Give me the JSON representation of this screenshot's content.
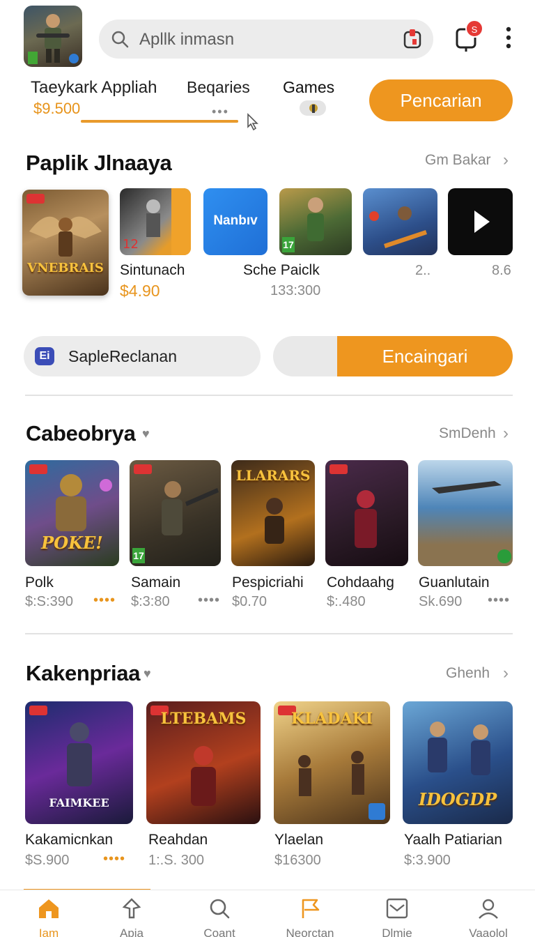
{
  "header": {
    "search_placeholder": "Apllk inmasn",
    "notification_count": "S",
    "app_title": "Taeykark Appliah",
    "app_price": "$9.500",
    "categories_label": "Beqaries",
    "games_label": "Games",
    "primary_button": "Pencarian",
    "progress": 1.0
  },
  "section1": {
    "title": "Paplik Jlnaaya",
    "link": "Gm Bakar",
    "featured_tile_text": "VNEBRAIS",
    "items": [
      {
        "name": "Sintunach",
        "price": "$4.90",
        "tile_text": ""
      },
      {
        "name": "Sche Paiclk",
        "price": "133:300",
        "tile_text": "Nanbıv"
      },
      {
        "name": "",
        "price": "2..",
        "tile_text": ""
      },
      {
        "name": "",
        "price": "8.6",
        "tile_text": ""
      }
    ]
  },
  "action_row": {
    "left_label": "SapleReclanan",
    "left_icon_text": "Ei",
    "right_label": "Encaingari"
  },
  "section2": {
    "title": "Cabeobrya",
    "link": "SmDenh",
    "items": [
      {
        "name": "Polk",
        "price": "$:S:390",
        "tile_text": "POKE!"
      },
      {
        "name": "Samain",
        "price": "$:3:80",
        "tile_text": ""
      },
      {
        "name": "Pespicriahi",
        "price": "$0.70",
        "tile_text": "LLARARS"
      },
      {
        "name": "Cohdaahg",
        "price": "$:.480",
        "tile_text": ""
      },
      {
        "name": "Guanlutain",
        "price": "Sk.690",
        "tile_text": ""
      }
    ],
    "rating_badge": "17"
  },
  "section3": {
    "title": "Kakenpriaa",
    "link": "Ghenh",
    "items": [
      {
        "name": "Kakamicnkan",
        "price": "$S.900",
        "tile_text": "FAIMKEE"
      },
      {
        "name": "Reahdan",
        "price": "1:.S. 300",
        "tile_text": "LTEBAMS"
      },
      {
        "name": "Ylaelan",
        "price": "$16300",
        "tile_text": "KLADAKI"
      },
      {
        "name": "Yaalh Patiarian",
        "price": "$:3.900",
        "tile_text": "IDOGDP"
      }
    ]
  },
  "bottom_nav": [
    {
      "label": "Iam",
      "icon": "home-icon"
    },
    {
      "label": "Apia",
      "icon": "pin-icon"
    },
    {
      "label": "Coant",
      "icon": "search-icon"
    },
    {
      "label": "Neorctan",
      "icon": "flag-icon"
    },
    {
      "label": "Dlmie",
      "icon": "mail-icon"
    },
    {
      "label": "Vaaolol",
      "icon": "profile-icon"
    }
  ],
  "colors": {
    "accent": "#ee961f",
    "pill_bg": "#ececec",
    "badge": "#e53935"
  }
}
